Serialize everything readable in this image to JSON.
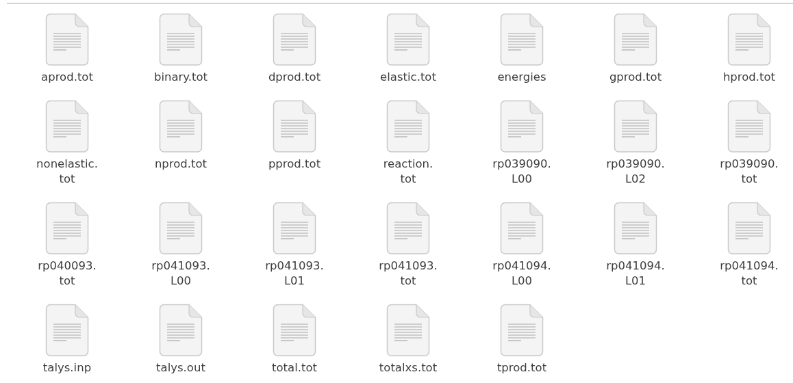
{
  "files": [
    {
      "lines": [
        "aprod.tot"
      ],
      "selected": false
    },
    {
      "lines": [
        "binary.tot"
      ],
      "selected": false
    },
    {
      "lines": [
        "dprod.tot"
      ],
      "selected": false
    },
    {
      "lines": [
        "elastic.tot"
      ],
      "selected": false
    },
    {
      "lines": [
        "energies"
      ],
      "selected": false
    },
    {
      "lines": [
        "gprod.tot"
      ],
      "selected": false
    },
    {
      "lines": [
        "hprod.tot"
      ],
      "selected": false
    },
    {
      "lines": [
        "nonelastic.",
        "tot"
      ],
      "selected": false
    },
    {
      "lines": [
        "nprod.tot"
      ],
      "selected": false
    },
    {
      "lines": [
        "pprod.tot"
      ],
      "selected": false
    },
    {
      "lines": [
        "reaction.",
        "tot"
      ],
      "selected": false
    },
    {
      "lines": [
        "rp039090.",
        "L00"
      ],
      "selected": false
    },
    {
      "lines": [
        "rp039090.",
        "L02"
      ],
      "selected": false
    },
    {
      "lines": [
        "rp039090.",
        "tot"
      ],
      "selected": false
    },
    {
      "lines": [
        "rp040093.",
        "tot"
      ],
      "selected": false
    },
    {
      "lines": [
        "rp041093.",
        "L00"
      ],
      "selected": false
    },
    {
      "lines": [
        "rp041093.",
        "L01"
      ],
      "selected": false
    },
    {
      "lines": [
        "rp041093.",
        "tot"
      ],
      "selected": false
    },
    {
      "lines": [
        "rp041094.",
        "L00"
      ],
      "selected": false
    },
    {
      "lines": [
        "rp041094.",
        "L01"
      ],
      "selected": false
    },
    {
      "lines": [
        "rp041094.",
        "tot"
      ],
      "selected": false
    },
    {
      "lines": [
        "talys.inp"
      ],
      "selected": false
    },
    {
      "lines": [
        "talys.out"
      ],
      "selected": false
    },
    {
      "lines": [
        "total.tot"
      ],
      "selected": false
    },
    {
      "lines": [
        "totalxs.tot"
      ],
      "selected": false
    },
    {
      "lines": [
        "tprod.tot"
      ],
      "selected": false
    }
  ]
}
